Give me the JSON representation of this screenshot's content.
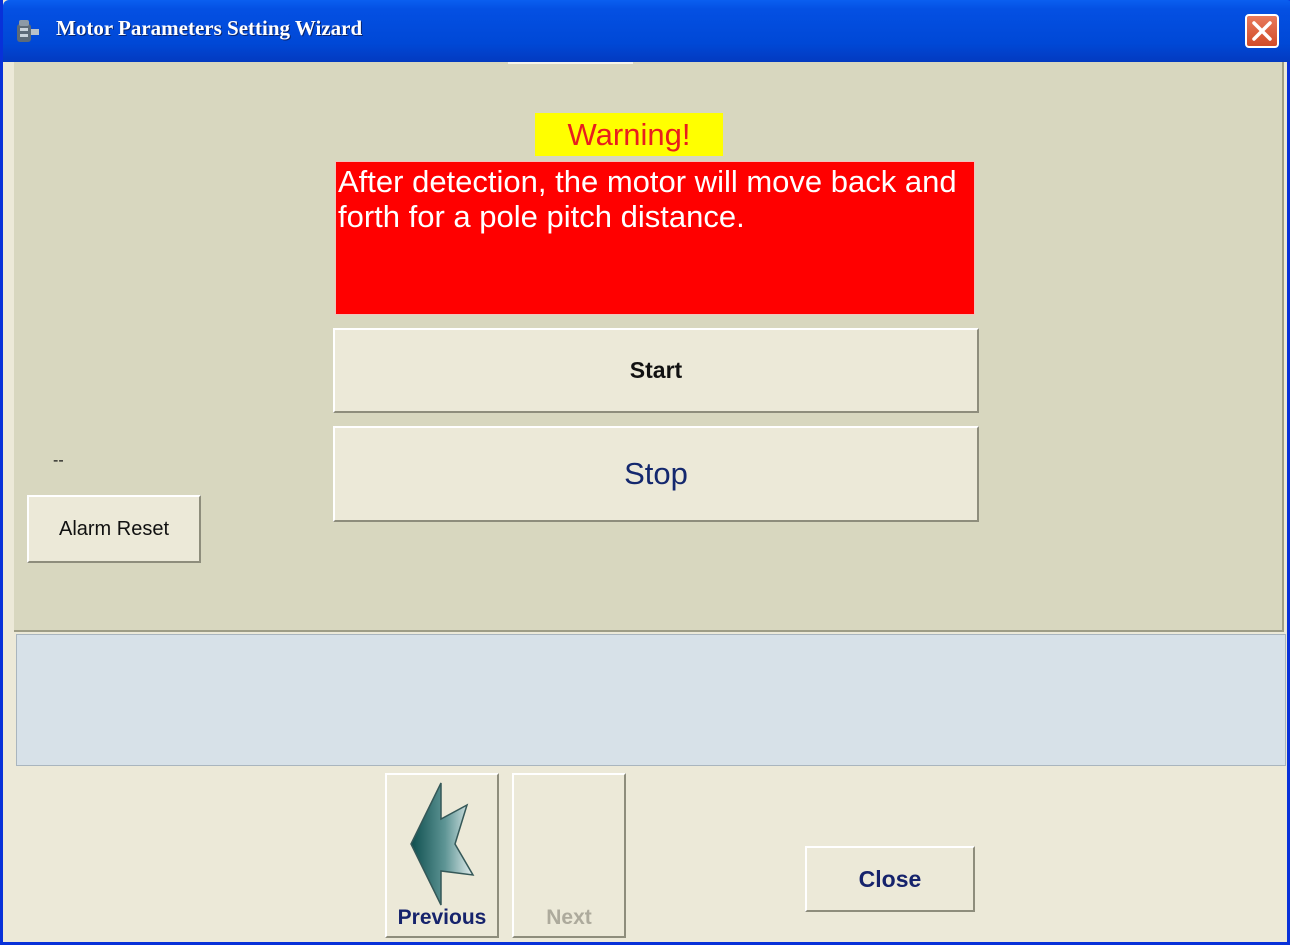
{
  "window": {
    "title": "Motor Parameters Setting Wizard",
    "close_icon": "close-x-icon"
  },
  "warning": {
    "title": "Warning!",
    "message": "After detection, the motor will move back and forth for a pole pitch distance."
  },
  "actions": {
    "start_label": "Start",
    "stop_label": "Stop"
  },
  "alarm": {
    "status_text": "--",
    "reset_label": "Alarm Reset"
  },
  "navigation": {
    "previous_label": "Previous",
    "next_label": "Next",
    "close_label": "Close"
  },
  "colors": {
    "titlebar": "#0048D6",
    "warning_title_bg": "#FFFF00",
    "warning_title_text": "#E81E1E",
    "warning_box_bg": "#FF0000",
    "status_panel_bg": "#D7E1E8"
  }
}
